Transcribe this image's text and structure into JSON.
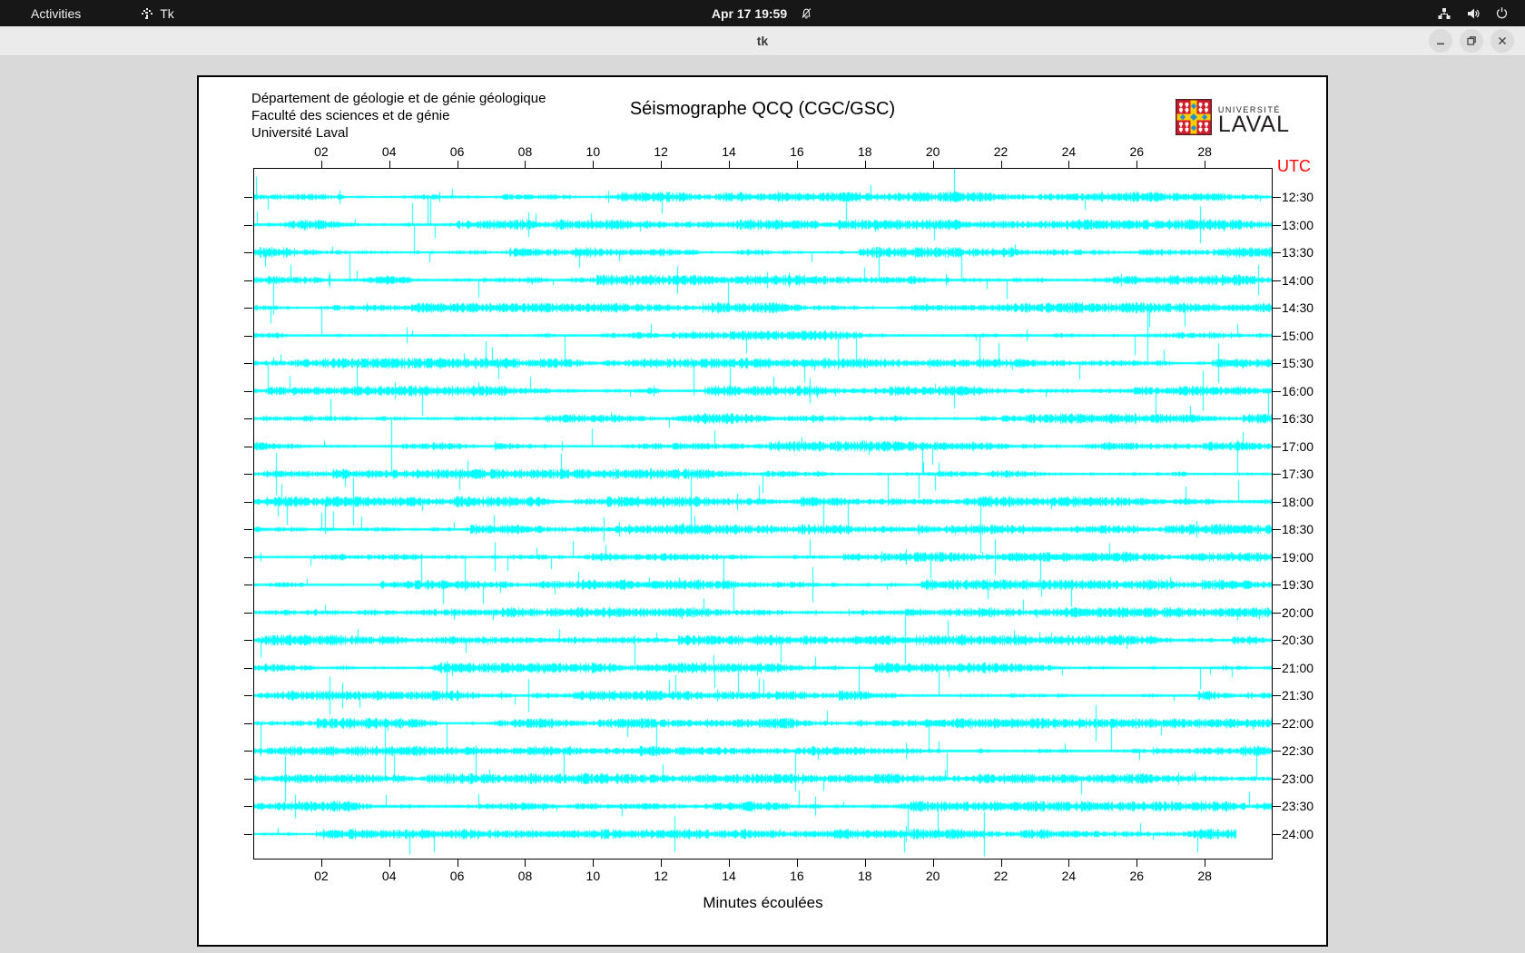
{
  "topbar": {
    "activities_label": "Activities",
    "app_name": "Tk",
    "clock": "Apr 17 19:59",
    "tray_icons": [
      "network-icon",
      "volume-icon",
      "power-icon"
    ]
  },
  "window": {
    "title": "tk",
    "controls": {
      "minimize": "minimize",
      "maximize": "maximize",
      "close": "close"
    }
  },
  "header": {
    "lines": [
      "Département de géologie et de génie géologique",
      "Faculté des sciences et de génie",
      "Université Laval"
    ],
    "title": "Séismographe QCQ (CGC/GSC)",
    "logo_small": "UNIVERSITÉ",
    "logo_large": "LAVAL"
  },
  "chart_data": {
    "type": "line",
    "subtype": "helicorder-seismogram",
    "title": "Séismographe QCQ (CGC/GSC)",
    "xlabel": "Minutes écoulées",
    "right_axis_title": "UTC",
    "x_range_minutes": [
      0,
      30
    ],
    "x_tick_labels": [
      "02",
      "04",
      "06",
      "08",
      "10",
      "12",
      "14",
      "16",
      "18",
      "20",
      "22",
      "24",
      "26",
      "28"
    ],
    "row_labels": [
      "12:30",
      "13:00",
      "13:30",
      "14:00",
      "14:30",
      "15:00",
      "15:30",
      "16:00",
      "16:30",
      "17:00",
      "17:30",
      "18:00",
      "18:30",
      "19:00",
      "19:30",
      "20:00",
      "20:30",
      "21:00",
      "21:30",
      "22:00",
      "22:30",
      "23:00",
      "23:30",
      "24:00"
    ],
    "minutes_per_row": 30,
    "last_row_end_fraction": 0.965,
    "trace_color": "#00ffff",
    "axis_color": "#000000",
    "utc_label_color": "#ff0000",
    "grid": false
  }
}
